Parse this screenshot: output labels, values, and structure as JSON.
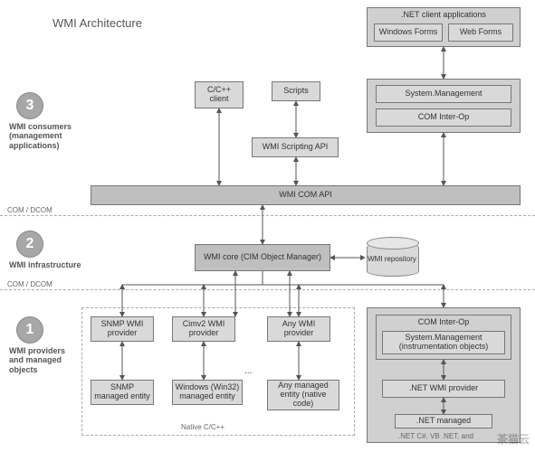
{
  "title": "WMI Architecture",
  "sections": {
    "s3": {
      "num": "3",
      "label": "WMI consumers (management applications)"
    },
    "s2": {
      "num": "2",
      "label": "WMI infrastructure"
    },
    "s1": {
      "num": "1",
      "label": "WMI providers and managed objects"
    }
  },
  "dividers": {
    "d1": "COM / DCOM",
    "d2": "COM / DCOM"
  },
  "top": {
    "netApps": ".NET client applications",
    "winForms": "Windows Forms",
    "webForms": "Web Forms",
    "cClient": "C/C++ client",
    "scripts": "Scripts",
    "sysMgmt": "System.Management",
    "comInterop": "COM Inter-Op",
    "scriptApi": "WMI Scripting API",
    "comApi": "WMI COM API"
  },
  "mid": {
    "core": "WMI core (CIM Object Manager)",
    "repo": "WMI repository"
  },
  "bottom": {
    "snmpProv": "SNMP WMI provider",
    "cimv2Prov": "Cimv2 WMI provider",
    "anyProv": "Any WMI provider",
    "snmpEnt": "SNMP managed entity",
    "winEnt": "Windows (Win32) managed entity",
    "anyEnt": "Any managed entity (native code)",
    "ellipsis": "...",
    "nativeGroup": "Native C/C++",
    "comInterop2": "COM Inter-Op",
    "sysMgmt2": "System.Management (instrumentation objects)",
    "netProv": ".NET WMI provider",
    "netManaged": ".NET managed",
    "netLangs": ".NET C#, VB .NET, and"
  },
  "watermark": "茶猫云"
}
